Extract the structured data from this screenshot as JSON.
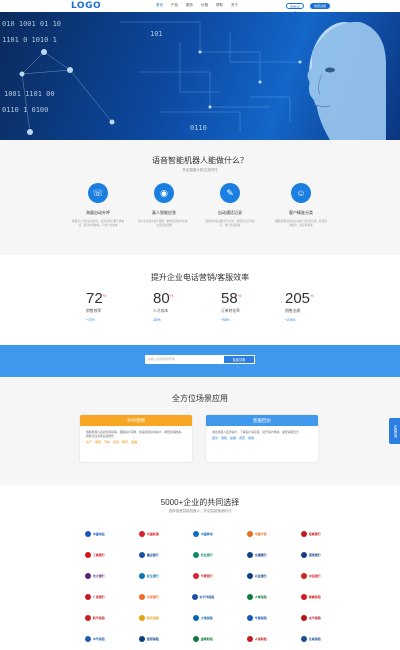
{
  "header": {
    "logo": "LOGO",
    "nav": [
      "首页",
      "产品",
      "服务",
      "价格",
      "帮助",
      "关于"
    ],
    "login_label": "登录/注册",
    "trial_label": "免费试用"
  },
  "features": {
    "title": "语音智能机器人能做什么？",
    "subtitle": "开启智能人机交互时代",
    "items": [
      {
        "icon": "phone-icon",
        "title": "海量自动外呼",
        "desc": "批量导入号码自动外呼，每天可拨打数千通电话，提升外呼效率，节省人力成本"
      },
      {
        "icon": "robot-icon",
        "title": "真人智能应答",
        "desc": "真人录音配合语义理解，精准识别客户意向，对话自然流畅"
      },
      {
        "icon": "record-icon",
        "title": "自动通话记录",
        "desc": "通话内容自动转文字记录，通话录音实时保存，便于复盘跟进"
      },
      {
        "icon": "user-icon",
        "title": "客户精准分类",
        "desc": "根据通话内容自动为客户打标签分类，筛选意向客户，提高转化率"
      }
    ]
  },
  "stats": {
    "title": "提升企业电话营销/客服效率",
    "items": [
      {
        "value": "72",
        "unit": "%",
        "label": "销售效率",
        "change": "+72%"
      },
      {
        "value": "80",
        "unit": "%",
        "label": "人才成本",
        "change": "-80%"
      },
      {
        "value": "58",
        "unit": "%",
        "label": "订单转化率",
        "change": "+58%"
      },
      {
        "value": "205",
        "unit": "%",
        "label": "销售业绩",
        "change": "+205%"
      }
    ]
  },
  "banner": {
    "placeholder": "请输入您的手机号码",
    "button_label": "免费试用"
  },
  "scenes": {
    "title": "全方位场景应用",
    "cards": [
      {
        "title": "外呼营销",
        "desc": "借助机器人自动外呼营销，把握客户需求，快速筛选意向客户，降低营销成本，帮助企业实现业绩增长",
        "tags": [
          "房产",
          "保险",
          "汽车",
          "贷款",
          "教育",
          "金融"
        ]
      },
      {
        "title": "客服回访",
        "desc": "通过机器人回访客户，了解客户满意度，提升客户体验，减轻客服压力",
        "tags": [
          "回访",
          "通知",
          "提醒",
          "调查",
          "催收"
        ]
      }
    ]
  },
  "side_tab": "在线咨询",
  "partners": {
    "title": "5000+企业的共同选择",
    "subtitle": "选择语音智能机器人，开启智能营销时代",
    "logos": [
      {
        "name": "中国电信",
        "color": "#1a56b8"
      },
      {
        "name": "中国联通",
        "color": "#d9242a"
      },
      {
        "name": "中国移动",
        "color": "#0f6cc4"
      },
      {
        "name": "中国平安",
        "color": "#e86e1b"
      },
      {
        "name": "招商银行",
        "color": "#c4161c"
      },
      {
        "name": "工商银行",
        "color": "#d71518"
      },
      {
        "name": "建设银行",
        "color": "#1b4fa0"
      },
      {
        "name": "农业银行",
        "color": "#0b8a6c"
      },
      {
        "name": "交通银行",
        "color": "#163f88"
      },
      {
        "name": "浦发银行",
        "color": "#173c8c"
      },
      {
        "name": "光大银行",
        "color": "#5b1f7e"
      },
      {
        "name": "民生银行",
        "color": "#0c74b8"
      },
      {
        "name": "华夏银行",
        "color": "#d8232a"
      },
      {
        "name": "兴业银行",
        "color": "#0a3f8c"
      },
      {
        "name": "中信银行",
        "color": "#d2231d"
      },
      {
        "name": "广发银行",
        "color": "#c8181e"
      },
      {
        "name": "平安银行",
        "color": "#f26a21"
      },
      {
        "name": "太平洋保险",
        "color": "#1b4fa0"
      },
      {
        "name": "人寿保险",
        "color": "#0f7b3e"
      },
      {
        "name": "泰康保险",
        "color": "#d21c20"
      },
      {
        "name": "新华保险",
        "color": "#c81e24"
      },
      {
        "name": "阳光保险",
        "color": "#e8a211"
      },
      {
        "name": "大地保险",
        "color": "#0a66b4"
      },
      {
        "name": "华泰保险",
        "color": "#1a56b8"
      },
      {
        "name": "太平保险",
        "color": "#b8121a"
      },
      {
        "name": "中华保险",
        "color": "#1e5fab"
      },
      {
        "name": "安邦保险",
        "color": "#0b3f85"
      },
      {
        "name": "国寿财险",
        "color": "#117a3a"
      },
      {
        "name": "人保财险",
        "color": "#c41e25"
      },
      {
        "name": "长城保险",
        "color": "#1a4e9a"
      }
    ]
  }
}
